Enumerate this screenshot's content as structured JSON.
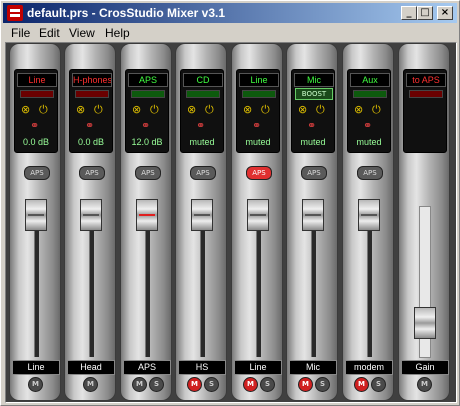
{
  "window": {
    "title": "default.prs - CrosStudio Mixer v3.1",
    "min": "_",
    "max": "□",
    "close": "×"
  },
  "menu": {
    "file": "File",
    "edit": "Edit",
    "view": "View",
    "help": "Help"
  },
  "colors": {
    "lcd_red": "#ff3030",
    "lcd_green": "#40ff40",
    "bar_red": "#6a0000",
    "bar_green": "#0d5a0d"
  },
  "channels": [
    {
      "lcd_label": "Line",
      "lcd_color": "red",
      "value": "0.0 dB",
      "aps": "APS",
      "aps_active": false,
      "name": "Line",
      "fader_pct": 100,
      "mute": "M",
      "mute_on": false,
      "solo": null
    },
    {
      "lcd_label": "H-phones",
      "lcd_color": "red",
      "value": "0.0 dB",
      "aps": "APS",
      "aps_active": false,
      "name": "Head",
      "fader_pct": 100,
      "mute": "M",
      "mute_on": false,
      "solo": null
    },
    {
      "lcd_label": "APS",
      "lcd_color": "green",
      "value": "12.0 dB",
      "aps": "APS",
      "aps_active": false,
      "name": "APS",
      "fader_pct": 100,
      "mute": "M",
      "mute_on": false,
      "solo": "S"
    },
    {
      "lcd_label": "CD",
      "lcd_color": "green",
      "value": "muted",
      "aps": "APS",
      "aps_active": false,
      "name": "HS",
      "fader_pct": 100,
      "mute": "M",
      "mute_on": true,
      "solo": "S"
    },
    {
      "lcd_label": "Line",
      "lcd_color": "green",
      "value": "muted",
      "aps": "APS",
      "aps_active": true,
      "name": "Line",
      "fader_pct": 100,
      "mute": "M",
      "mute_on": true,
      "solo": "S"
    },
    {
      "lcd_label": "Mic",
      "lcd_color": "green",
      "boost": "BOOST",
      "value": "muted",
      "aps": "APS",
      "aps_active": false,
      "name": "Mic",
      "fader_pct": 100,
      "mute": "M",
      "mute_on": true,
      "solo": "S"
    },
    {
      "lcd_label": "Aux",
      "lcd_color": "green",
      "value": "muted",
      "aps": "APS",
      "aps_active": false,
      "name": "modem",
      "fader_pct": 100,
      "mute": "M",
      "mute_on": true,
      "solo": "S"
    },
    {
      "lcd_label": "to APS",
      "lcd_color": "red",
      "value": "",
      "aps": "",
      "aps_active": false,
      "name": "Gain",
      "fader_pct": 10,
      "mute": "M",
      "mute_on": false,
      "solo": null
    }
  ],
  "icons": {
    "phase": "phase-icon",
    "power": "power-icon",
    "link": "link-icon"
  }
}
